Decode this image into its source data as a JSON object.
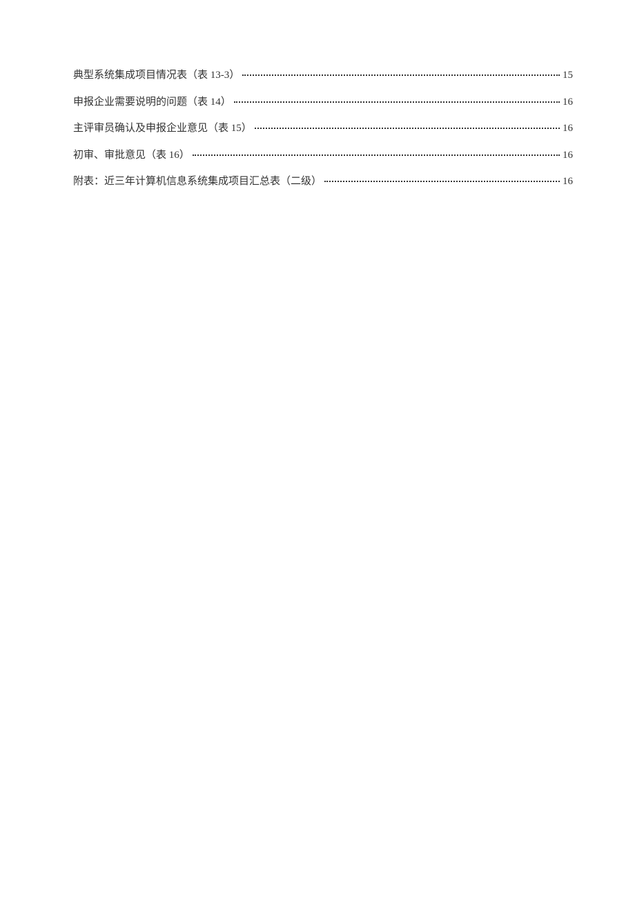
{
  "toc": {
    "entries": [
      {
        "title": "典型系统集成项目情况表（表 13-3）",
        "page": "15"
      },
      {
        "title": "申报企业需要说明的问题（表 14）",
        "page": "16"
      },
      {
        "title": "主评审员确认及申报企业意见（表 15）",
        "page": "16"
      },
      {
        "title": "初审、审批意见（表 16）",
        "page": "16"
      },
      {
        "title": "附表：近三年计算机信息系统集成项目汇总表（二级）",
        "page": "16"
      }
    ]
  }
}
